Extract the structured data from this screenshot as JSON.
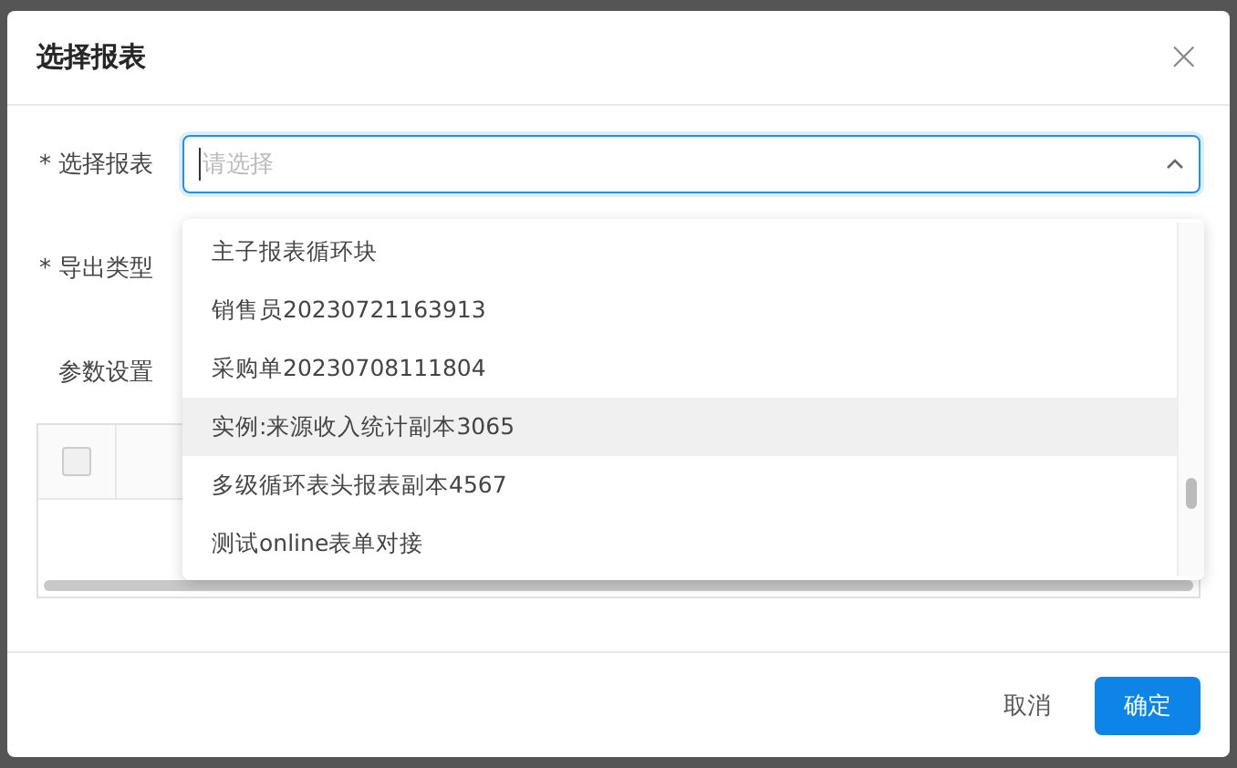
{
  "dialog": {
    "title": "选择报表",
    "close_icon": "×"
  },
  "required_mark": "*",
  "form": [
    {
      "kind": "select",
      "required": true,
      "label": "选择报表",
      "placeholder": "请选择",
      "open": true
    },
    {
      "kind": "select",
      "required": true,
      "label": "导出类型"
    },
    {
      "kind": "table",
      "required": false,
      "label": "参数设置"
    }
  ],
  "dropdown": {
    "options": [
      {
        "label": "主子报表循环块",
        "selected": false
      },
      {
        "label": "销售员20230721163913",
        "selected": false
      },
      {
        "label": "采购单20230708111804",
        "selected": false
      },
      {
        "label": "实例:来源收入统计副本3065",
        "selected": true
      },
      {
        "label": "多级循环表头报表副本4567",
        "selected": false
      },
      {
        "label": "测试online表单对接",
        "selected": false
      }
    ]
  },
  "table": {
    "header_checkbox": {
      "checked": false
    }
  },
  "buttons": [
    {
      "label": "取消",
      "kind": "default"
    },
    {
      "label": "确定",
      "kind": "primary"
    }
  ]
}
